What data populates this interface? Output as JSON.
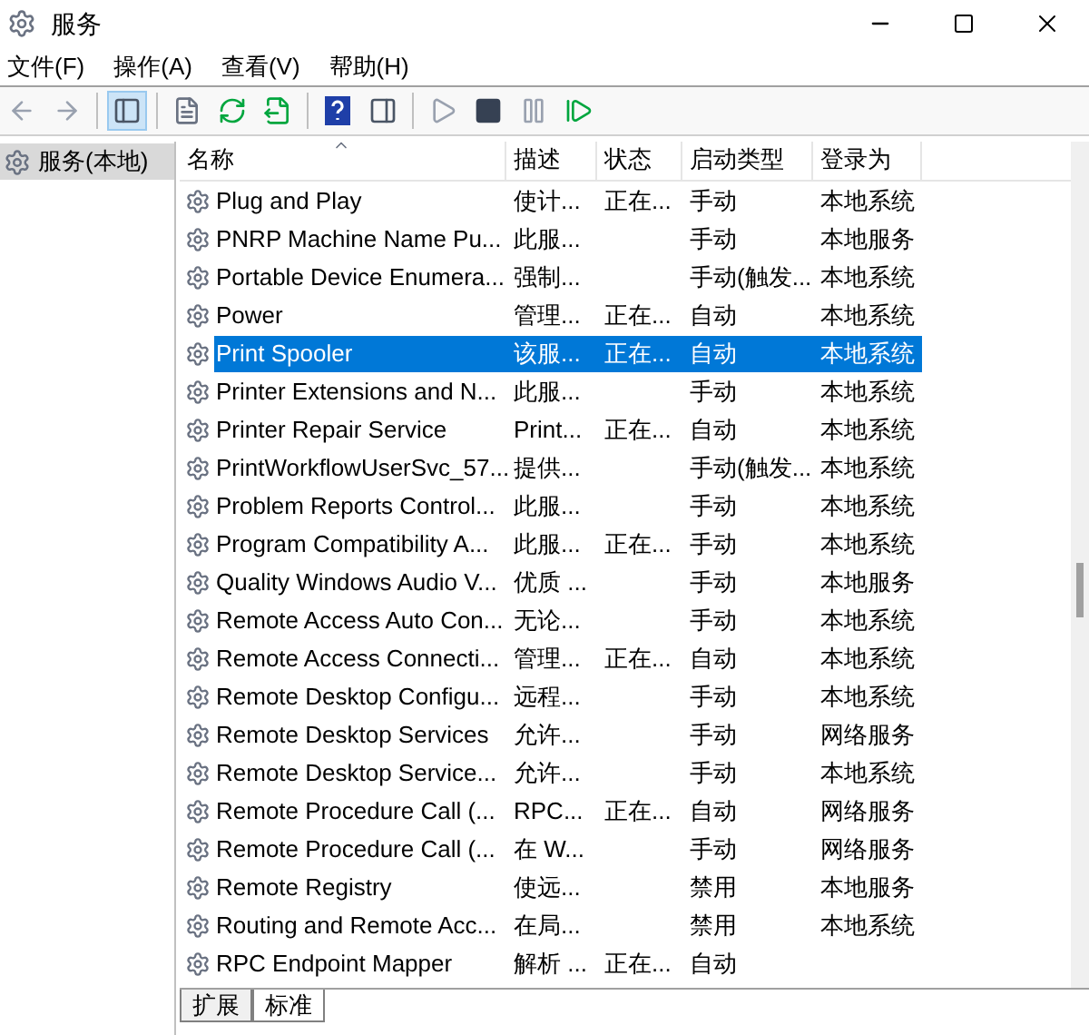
{
  "window": {
    "title": "服务"
  },
  "menu": [
    "文件(F)",
    "操作(A)",
    "查看(V)",
    "帮助(H)"
  ],
  "toolbar": [
    {
      "kind": "back",
      "pressed": false
    },
    {
      "kind": "forward",
      "pressed": false
    },
    {
      "kind": "tree",
      "pressed": true
    },
    {
      "kind": "properties",
      "pressed": false
    },
    {
      "kind": "refresh",
      "pressed": false
    },
    {
      "kind": "export",
      "pressed": false
    },
    {
      "kind": "help",
      "pressed": false
    },
    {
      "kind": "action",
      "pressed": false
    },
    {
      "kind": "start",
      "pressed": false
    },
    {
      "kind": "stop",
      "pressed": false
    },
    {
      "kind": "pause",
      "pressed": false
    },
    {
      "kind": "restart",
      "pressed": false
    }
  ],
  "tree": [
    {
      "label": "服务(本地)",
      "selected": true
    }
  ],
  "table": {
    "columns": [
      "名称",
      "描述",
      "状态",
      "启动类型",
      "登录为"
    ],
    "rows": [
      {
        "name": "Plug and Play",
        "desc": "使计...",
        "status": "正在...",
        "startup": "手动",
        "logon": "本地系统",
        "selected": false
      },
      {
        "name": "PNRP Machine Name Pu...",
        "desc": "此服...",
        "startup": "手动",
        "logon": "本地服务",
        "selected": false
      },
      {
        "name": "Portable Device Enumera...",
        "desc": "强制...",
        "startup": "手动(触发...",
        "logon": "本地系统",
        "selected": false
      },
      {
        "name": "Power",
        "desc": "管理...",
        "status": "正在...",
        "startup": "自动",
        "logon": "本地系统",
        "selected": false
      },
      {
        "name": "Print Spooler",
        "desc": "该服...",
        "status": "正在...",
        "startup": "自动",
        "logon": "本地系统",
        "selected": true
      },
      {
        "name": "Printer Extensions and N...",
        "desc": "此服...",
        "startup": "手动",
        "logon": "本地系统",
        "selected": false
      },
      {
        "name": "Printer Repair Service",
        "desc": "Print...",
        "status": "正在...",
        "startup": "自动",
        "logon": "本地系统",
        "selected": false
      },
      {
        "name": "PrintWorkflowUserSvc_57...",
        "desc": "提供...",
        "startup": "手动(触发...",
        "logon": "本地系统",
        "selected": false
      },
      {
        "name": "Problem Reports Control...",
        "desc": "此服...",
        "startup": "手动",
        "logon": "本地系统",
        "selected": false
      },
      {
        "name": "Program Compatibility A...",
        "desc": "此服...",
        "status": "正在...",
        "startup": "手动",
        "logon": "本地系统",
        "selected": false
      },
      {
        "name": "Quality Windows Audio V...",
        "desc": "优质 ...",
        "startup": "手动",
        "logon": "本地服务",
        "selected": false
      },
      {
        "name": "Remote Access Auto Con...",
        "desc": "无论...",
        "startup": "手动",
        "logon": "本地系统",
        "selected": false
      },
      {
        "name": "Remote Access Connecti...",
        "desc": "管理...",
        "status": "正在...",
        "startup": "自动",
        "logon": "本地系统",
        "selected": false
      },
      {
        "name": "Remote Desktop Configu...",
        "desc": "远程...",
        "startup": "手动",
        "logon": "本地系统",
        "selected": false
      },
      {
        "name": "Remote Desktop Services",
        "desc": "允许...",
        "startup": "手动",
        "logon": "网络服务",
        "selected": false
      },
      {
        "name": "Remote Desktop Service...",
        "desc": "允许...",
        "startup": "手动",
        "logon": "本地系统",
        "selected": false
      },
      {
        "name": "Remote Procedure Call (...",
        "desc": "RPC...",
        "status": "正在...",
        "startup": "自动",
        "logon": "网络服务",
        "selected": false
      },
      {
        "name": "Remote Procedure Call (...",
        "desc": "在 W...",
        "startup": "手动",
        "logon": "网络服务",
        "selected": false
      },
      {
        "name": "Remote Registry",
        "desc": "使远...",
        "startup": "禁用",
        "logon": "本地服务",
        "selected": false
      },
      {
        "name": "Routing and Remote Acc...",
        "desc": "在局...",
        "startup": "禁用",
        "logon": "本地系统",
        "selected": false
      },
      {
        "name": "RPC Endpoint Mapper",
        "desc": "解析 ...",
        "status": "正在...",
        "startup": "自动",
        "selected": false
      }
    ]
  },
  "tabs": [
    {
      "label": "扩展",
      "selected": false
    },
    {
      "label": "标准",
      "selected": true
    }
  ]
}
